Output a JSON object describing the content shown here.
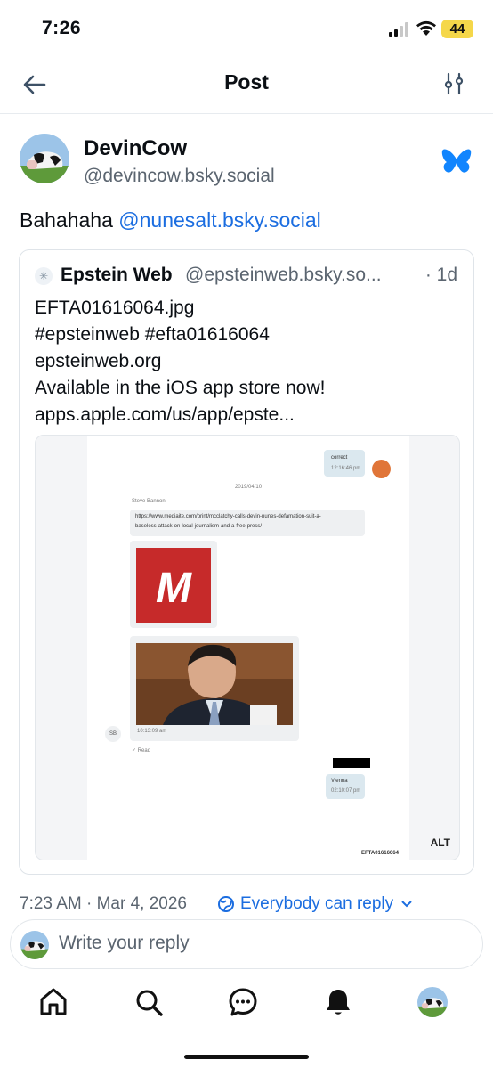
{
  "status_bar": {
    "time": "7:26",
    "battery": "44"
  },
  "header": {
    "title": "Post",
    "back_icon": "arrow-left-icon",
    "settings_icon": "sliders-icon"
  },
  "post": {
    "author_name": "DevinCow",
    "author_handle": "@devincow.bsky.social",
    "text_prefix": "Bahahaha ",
    "mention": "@nunesalt.bsky.social",
    "timestamp": "7:23 AM · Mar 4, 2026",
    "reply_permission": "Everybody can reply"
  },
  "quote": {
    "author_name": "Epstein Web",
    "author_handle": "@epsteinweb.bsky.so...",
    "time": "· 1d",
    "lines": [
      "EFTA01616064.jpg",
      "#epsteinweb #efta01616064",
      "epsteinweb.org",
      "Available in the iOS app store now!",
      "apps.apple.com/us/app/epste..."
    ],
    "image": {
      "alt_label": "ALT",
      "msg_correct": "correct",
      "msg_correct_time": "12:16:46 pm",
      "date_separator": "2019/04/10",
      "sender": "Steve Bannon",
      "link_line1": "https://www.mediaite.com/print/mcclatchy-calls-devin-nunes-defamation-suit-a-",
      "link_line2": "baseless-attack-on-local-journalism-and-a-free-press/",
      "logo_letter": "M",
      "photo_time": "10:13:09 am",
      "sender_initials": "SB",
      "read_label": "✓ Read",
      "msg_vienna": "Vienna",
      "msg_vienna_time": "02:10:07 pm",
      "doc_id": "EFTA01616064"
    }
  },
  "reply_box": {
    "placeholder": "Write your reply"
  },
  "nav": [
    "home-icon",
    "search-icon",
    "chat-icon",
    "bell-icon",
    "profile-avatar"
  ],
  "colors": {
    "accent": "#1b6de0",
    "text": "#0b0f14",
    "muted": "#5b6570",
    "bluesky": "#1185fe",
    "logo_red": "#c62a2a"
  }
}
